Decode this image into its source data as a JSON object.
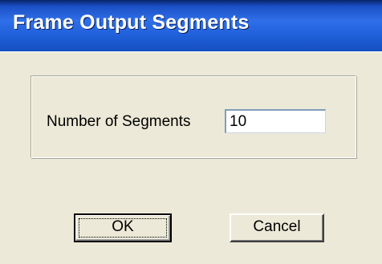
{
  "window": {
    "title": "Frame Output Segments"
  },
  "form": {
    "segments_label": "Number of Segments",
    "segments_value": "10"
  },
  "buttons": {
    "ok_label": "OK",
    "cancel_label": "Cancel"
  },
  "colors": {
    "title_bar": "#2f6fe8",
    "dialog_background": "#ece9d8",
    "title_text": "#ffffff"
  }
}
